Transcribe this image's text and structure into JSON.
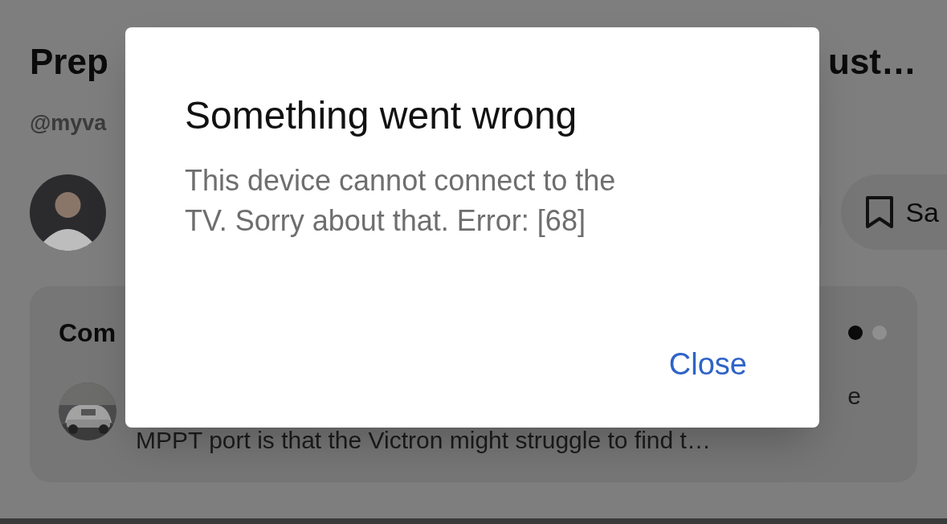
{
  "page": {
    "title_start": "Prep",
    "title_end": "ust…",
    "handle": "@myva",
    "save_button": "Sa",
    "comments": {
      "heading": "Com",
      "pager": [
        {
          "selected": true
        },
        {
          "selected": false
        }
      ],
      "comment_line_end": "e",
      "comment_line": "MPPT port is that the Victron might struggle to find t…"
    }
  },
  "dialog": {
    "title": "Something went wrong",
    "message": "This device cannot connect to the TV. Sorry about that. Error: [68]",
    "buttons": [
      "Close"
    ]
  }
}
